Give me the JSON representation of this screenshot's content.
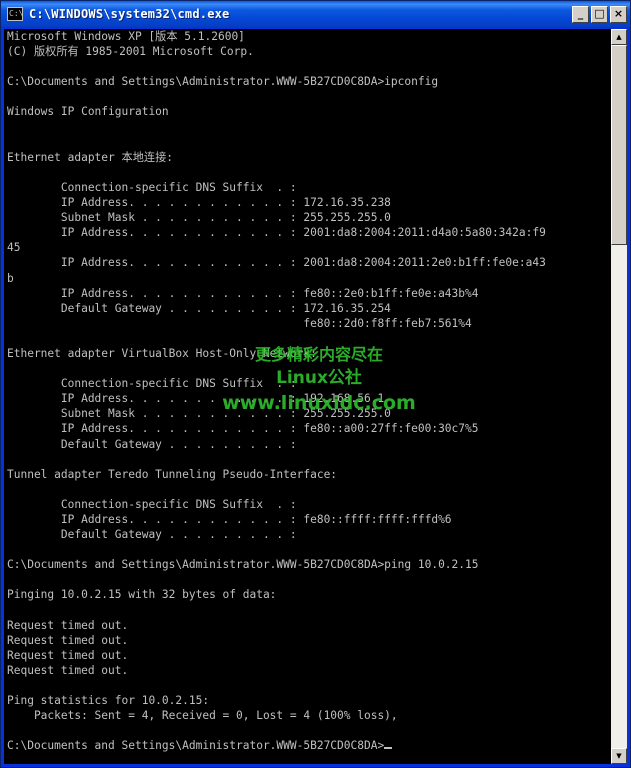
{
  "window": {
    "title": "C:\\WINDOWS\\system32\\cmd.exe",
    "icon": "cmd-icon",
    "minimize_label": "_",
    "maximize_label": "□",
    "close_label": "×"
  },
  "console": {
    "text_color": "#c0c0c0",
    "background_color": "#000000",
    "lines": [
      "Microsoft Windows XP [版本 5.1.2600]",
      "(C) 版权所有 1985-2001 Microsoft Corp.",
      "",
      "C:\\Documents and Settings\\Administrator.WWW-5B27CD0C8DA>ipconfig",
      "",
      "Windows IP Configuration",
      "",
      "",
      "Ethernet adapter 本地连接:",
      "",
      "        Connection-specific DNS Suffix  . :",
      "        IP Address. . . . . . . . . . . . : 172.16.35.238",
      "        Subnet Mask . . . . . . . . . . . : 255.255.255.0",
      "        IP Address. . . . . . . . . . . . : 2001:da8:2004:2011:d4a0:5a80:342a:f9",
      "45",
      "        IP Address. . . . . . . . . . . . : 2001:da8:2004:2011:2e0:b1ff:fe0e:a43",
      "b",
      "        IP Address. . . . . . . . . . . . : fe80::2e0:b1ff:fe0e:a43b%4",
      "        Default Gateway . . . . . . . . . : 172.16.35.254",
      "                                            fe80::2d0:f8ff:feb7:561%4",
      "",
      "Ethernet adapter VirtualBox Host-Only Network:",
      "",
      "        Connection-specific DNS Suffix  . :",
      "        IP Address. . . . . . . . . . . . : 192.168.56.1",
      "        Subnet Mask . . . . . . . . . . . : 255.255.255.0",
      "        IP Address. . . . . . . . . . . . : fe80::a00:27ff:fe00:30c7%5",
      "        Default Gateway . . . . . . . . . :",
      "",
      "Tunnel adapter Teredo Tunneling Pseudo-Interface:",
      "",
      "        Connection-specific DNS Suffix  . :",
      "        IP Address. . . . . . . . . . . . : fe80::ffff:ffff:fffd%6",
      "        Default Gateway . . . . . . . . . :",
      "",
      "C:\\Documents and Settings\\Administrator.WWW-5B27CD0C8DA>ping 10.0.2.15",
      "",
      "Pinging 10.0.2.15 with 32 bytes of data:",
      "",
      "Request timed out.",
      "Request timed out.",
      "Request timed out.",
      "Request timed out.",
      "",
      "Ping statistics for 10.0.2.15:",
      "    Packets: Sent = 4, Received = 0, Lost = 4 (100% loss),",
      "",
      "C:\\Documents and Settings\\Administrator.WWW-5B27CD0C8DA>"
    ]
  },
  "scrollbar": {
    "up_arrow": "▲",
    "down_arrow": "▼"
  },
  "watermark": {
    "line1": "更多精彩内容尽在",
    "line2": "Linux公社",
    "line3": "www.linuxidc.com",
    "color": "#2fbf2f"
  }
}
